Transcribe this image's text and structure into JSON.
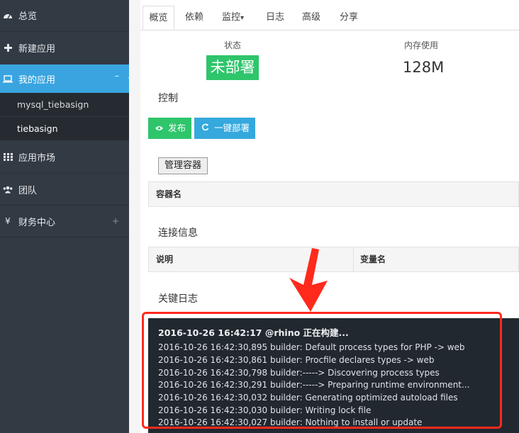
{
  "sidebar": {
    "items": [
      {
        "id": "overview",
        "label": "总览",
        "icon": "dashboard-icon"
      },
      {
        "id": "new-app",
        "label": "新建应用",
        "icon": "plus-icon"
      },
      {
        "id": "my-apps",
        "label": "我的应用",
        "icon": "laptop-icon",
        "active_mark": "–"
      },
      {
        "id": "app-market",
        "label": "应用市场",
        "icon": "grid-icon"
      },
      {
        "id": "team",
        "label": "团队",
        "icon": "users-icon"
      },
      {
        "id": "finance",
        "label": "财务中心",
        "icon": "yen-icon",
        "glyph": "¥",
        "expand_mark": "+"
      }
    ],
    "sub_items": [
      {
        "label": "mysql_tiebasign"
      },
      {
        "label": "tiebasign"
      }
    ]
  },
  "tabs": [
    {
      "label": "概览"
    },
    {
      "label": "依赖"
    },
    {
      "label": "监控",
      "caret": "▾"
    },
    {
      "label": "日志"
    },
    {
      "label": "高级"
    },
    {
      "label": "分享"
    }
  ],
  "stats": {
    "status_label": "状态",
    "status_value": "未部署",
    "memory_label": "内存使用",
    "memory_value": "128M"
  },
  "control": {
    "title": "控制",
    "publish_label": "发布",
    "deploy_label": "一键部署",
    "manage_container_label": "管理容器"
  },
  "container_table": {
    "headers": [
      "容器名"
    ]
  },
  "connection": {
    "title": "连接信息",
    "headers": [
      "说明",
      "变量名"
    ]
  },
  "logs": {
    "title": "关键日志",
    "header": "2016-10-26 16:42:17 @rhino 正在构建...",
    "lines": [
      "2016-10-26 16:42:30,895 builder: Default process types for PHP -> web",
      "2016-10-26 16:42:30,861 builder: Procfile declares types -> web",
      "2016-10-26 16:42:30,798 builder:-----> Discovering process types",
      "2016-10-26 16:42:30,291 builder:-----> Preparing runtime environment...",
      "2016-10-26 16:42:30,032 builder: Generating optimized autoload files",
      "2016-10-26 16:42:30,030 builder: Writing lock file",
      "2016-10-26 16:42:30,027 builder: Nothing to install or update"
    ]
  },
  "colors": {
    "sidebar_bg": "#323a44",
    "active_blue": "#39a4e0",
    "status_green": "#2ec56b",
    "deploy_blue": "#35a8dd",
    "log_bg": "#222830",
    "annotation_red": "#ff2a1c"
  }
}
